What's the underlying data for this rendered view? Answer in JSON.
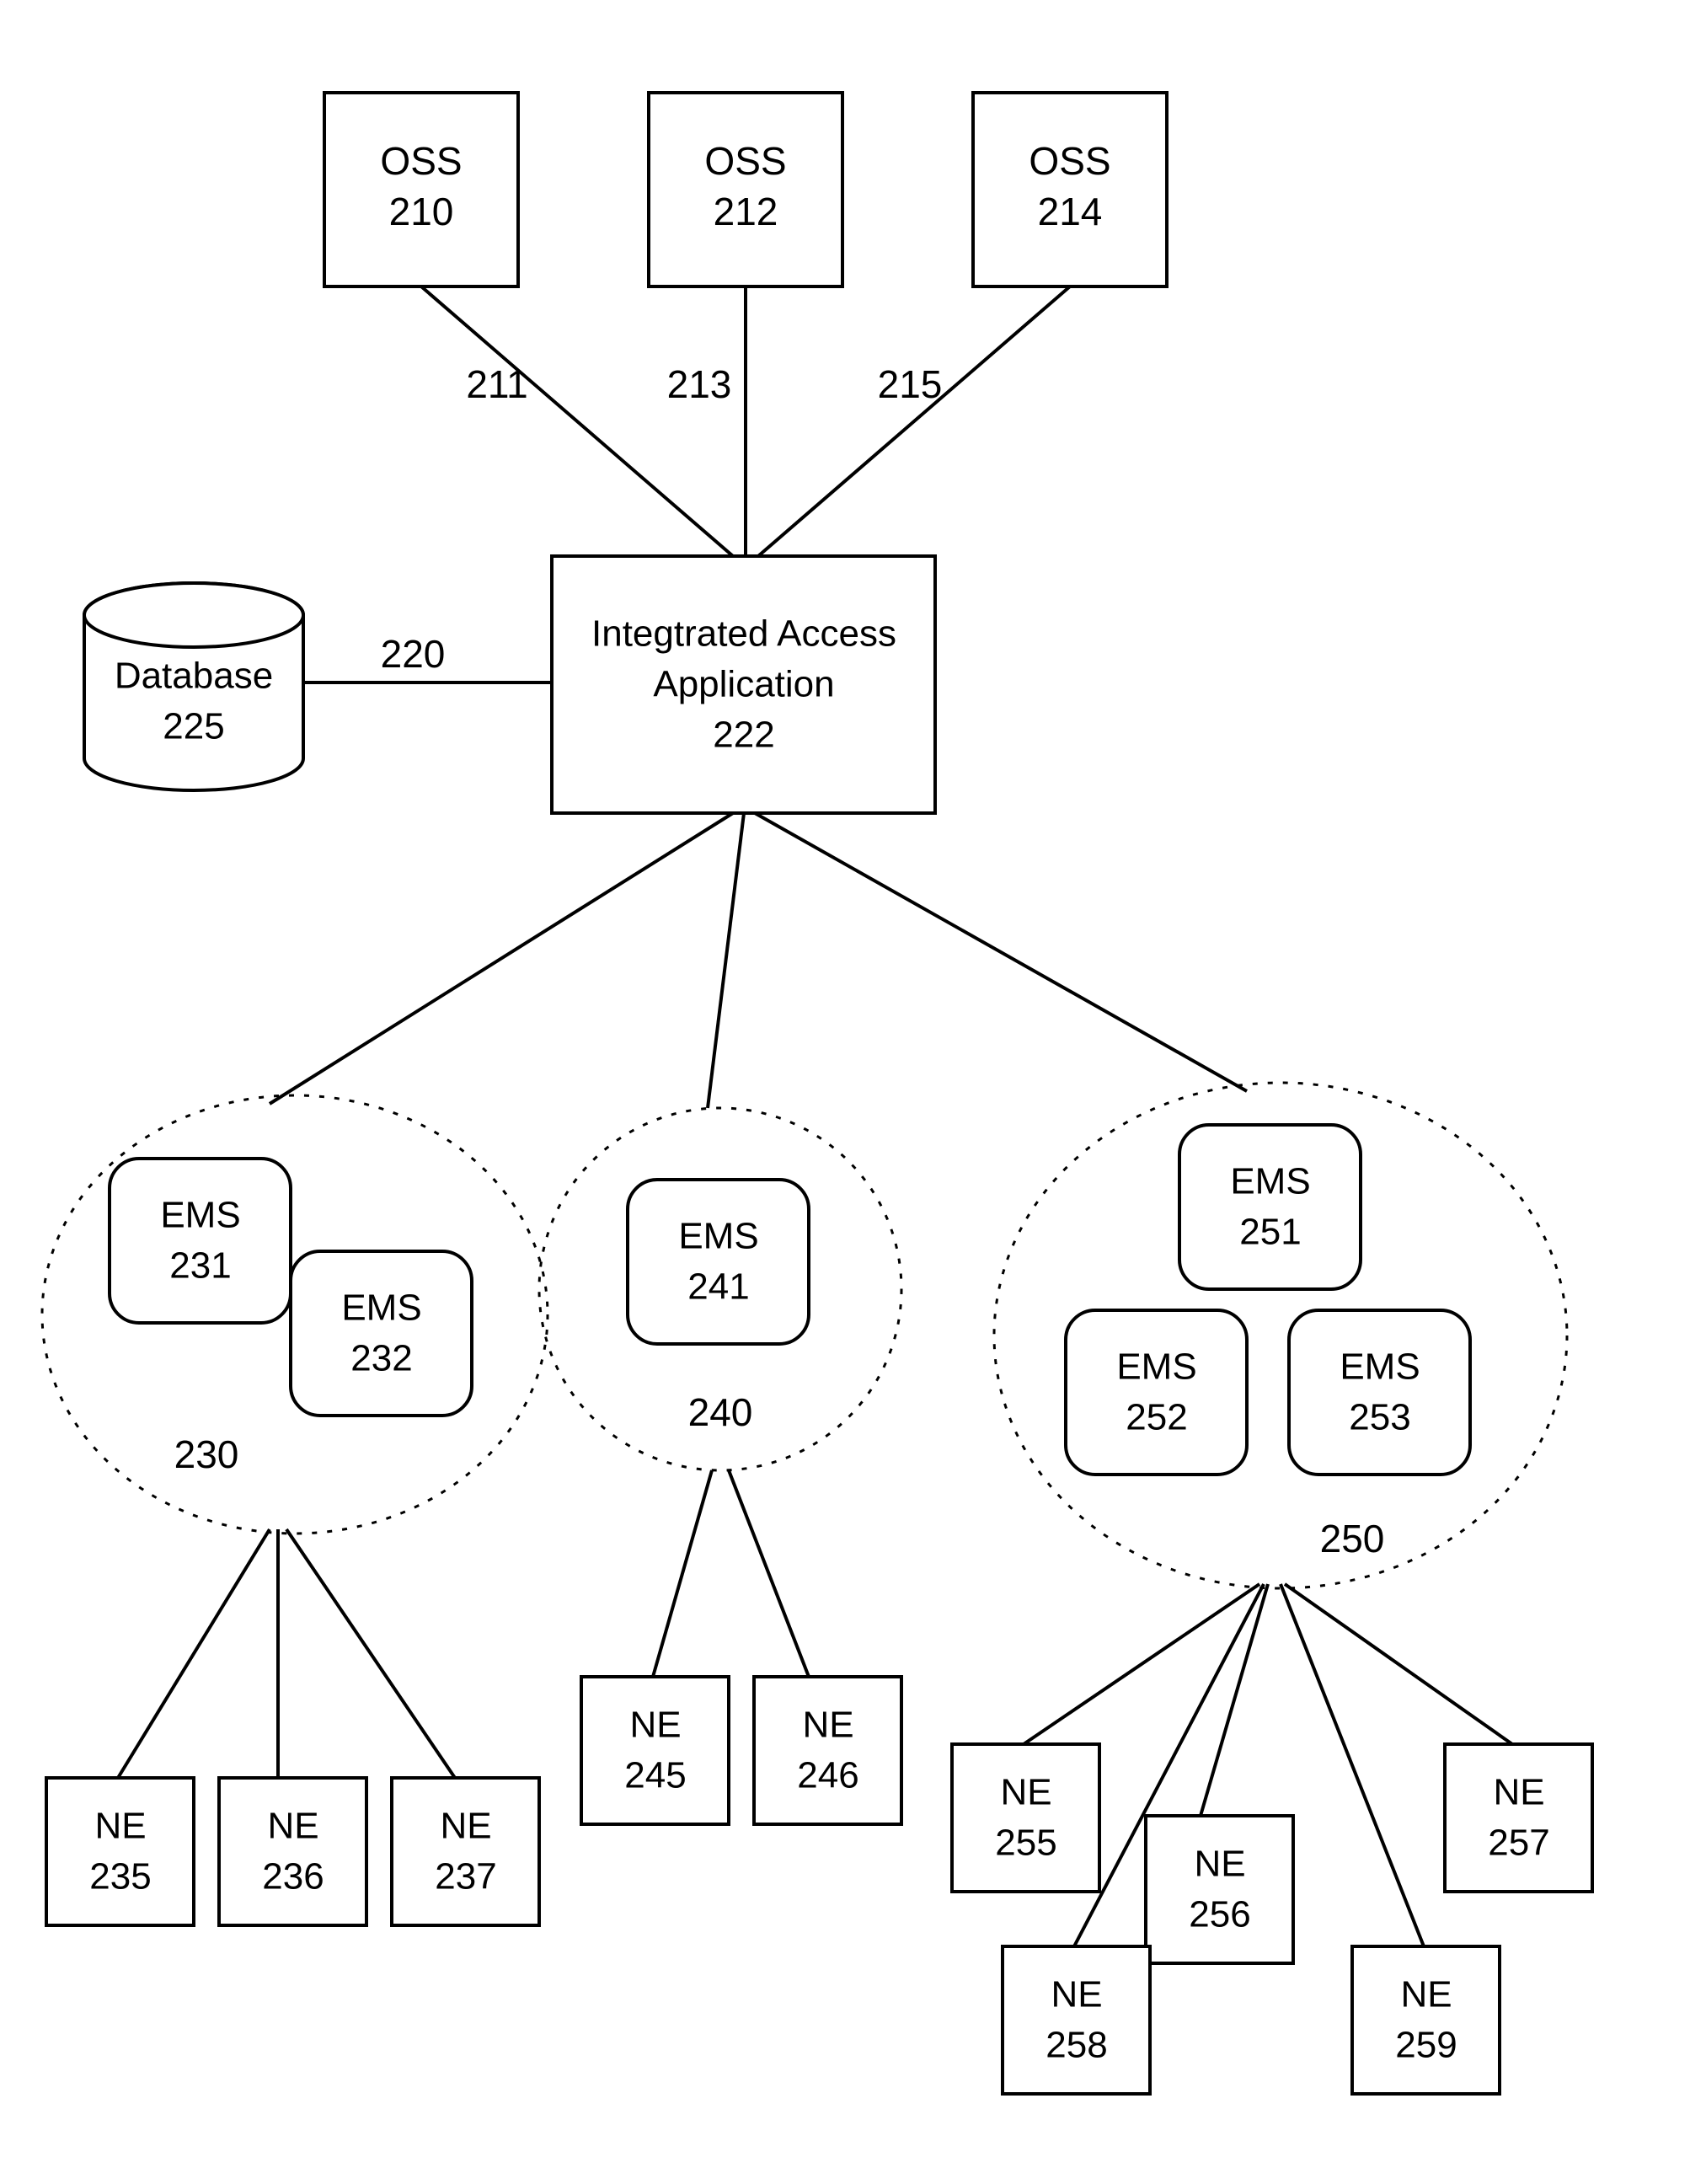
{
  "oss": [
    {
      "label": "OSS",
      "id": "210",
      "edge": "211"
    },
    {
      "label": "OSS",
      "id": "212",
      "edge": "213"
    },
    {
      "label": "OSS",
      "id": "214",
      "edge": "215"
    }
  ],
  "iaa": {
    "label1": "Integtrated Access",
    "label2": "Application",
    "id": "222"
  },
  "db": {
    "label": "Database",
    "id": "225",
    "edge": "220"
  },
  "group230": {
    "id": "230",
    "ems": [
      {
        "label": "EMS",
        "id": "231"
      },
      {
        "label": "EMS",
        "id": "232"
      }
    ],
    "ne": [
      {
        "label": "NE",
        "id": "235"
      },
      {
        "label": "NE",
        "id": "236"
      },
      {
        "label": "NE",
        "id": "237"
      }
    ]
  },
  "group240": {
    "id": "240",
    "ems": [
      {
        "label": "EMS",
        "id": "241"
      }
    ],
    "ne": [
      {
        "label": "NE",
        "id": "245"
      },
      {
        "label": "NE",
        "id": "246"
      }
    ]
  },
  "group250": {
    "id": "250",
    "ems": [
      {
        "label": "EMS",
        "id": "251"
      },
      {
        "label": "EMS",
        "id": "252"
      },
      {
        "label": "EMS",
        "id": "253"
      }
    ],
    "ne": [
      {
        "label": "NE",
        "id": "255"
      },
      {
        "label": "NE",
        "id": "256"
      },
      {
        "label": "NE",
        "id": "257"
      },
      {
        "label": "NE",
        "id": "258"
      },
      {
        "label": "NE",
        "id": "259"
      }
    ]
  }
}
